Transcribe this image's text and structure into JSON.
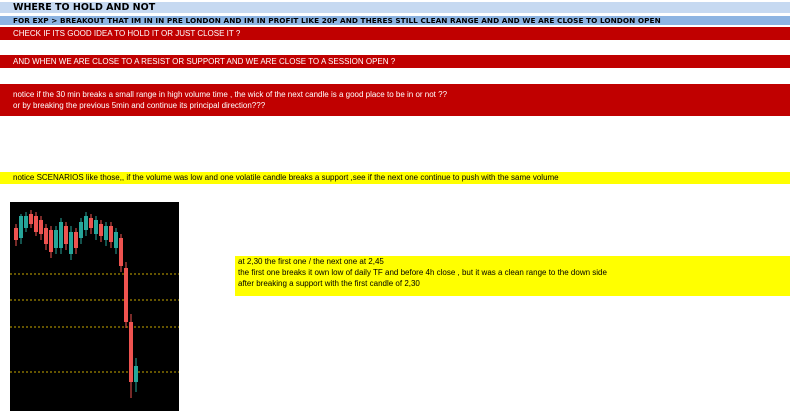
{
  "header": {
    "title": "WHERE TO HOLD AND NOT",
    "example": "FOR EXP > BREAKOUT THAT IM IN IN PRE LONDON AND IM IN PROFIT LIKE 20P AND THERES STILL CLEAN RANGE AND AND WE ARE CLOSE TO LONDON OPEN"
  },
  "questions": {
    "q1": "CHECK IF ITS GOOD IDEA TO HOLD IT OR JUST CLOSE IT ?",
    "q2": "AND WHEN WE ARE CLOSE TO A RESIST OR SUPPORT AND WE ARE CLOSE TO A SESSION OPEN ?",
    "q3_line1": "notice if the 30 min breaks a small range in high volume time , the wick of the next candle is a good place to be in or not ??",
    "q3_line2": "or by breaking the previous 5min and continue its principal direction???"
  },
  "scenarios": {
    "text": "notice SCENARIOS  like those,, if the volume was low and one volatile candle breaks a support ,see if the next one continue to push with the same volume"
  },
  "note": {
    "line1": "at 2,30 the first one / the next one at 2,45",
    "line2": "the first one breaks it own low of daily TF and before 4h close , but it was a clean range to the down side",
    "line3": "after breaking a support with the first candle of 2,30"
  },
  "colors": {
    "bull": "#26a69a",
    "bear": "#ef5350",
    "dotted_line": "#c8a800"
  }
}
